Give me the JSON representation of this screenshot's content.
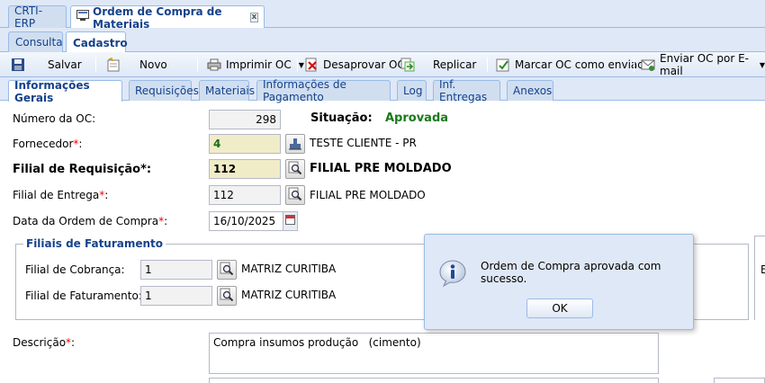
{
  "window_tabs": [
    {
      "label": "CRTI-ERP"
    },
    {
      "label": "Ordem de Compra de Materiais",
      "close": "x"
    }
  ],
  "mode_tabs": [
    {
      "label": "Consulta"
    },
    {
      "label": "Cadastro"
    }
  ],
  "toolbar": {
    "save": "Salvar",
    "new": "Novo",
    "print": "Imprimir OC",
    "disapprove": "Desaprovar OC",
    "replicate": "Replicar",
    "mark_sent": "Marcar OC como enviada",
    "send_email": "Enviar OC por E-mail"
  },
  "section_tabs": [
    {
      "label": "Informações Gerais"
    },
    {
      "label": "Requisições"
    },
    {
      "label": "Materiais"
    },
    {
      "label": "Informações de Pagamento"
    },
    {
      "label": "Log"
    },
    {
      "label": "Inf. Entregas"
    },
    {
      "label": "Anexos"
    }
  ],
  "form": {
    "oc_number_label": "Número da OC:",
    "oc_number": "298",
    "status_label": "Situação:",
    "status": "Aprovada",
    "status_color": "#1a7a1a",
    "supplier_label": "Fornecedor",
    "supplier_code": "4",
    "supplier_name": "TESTE CLIENTE - PR",
    "req_branch_label": "Filial de Requisição",
    "req_branch_code": "112",
    "req_branch_name": "FILIAL PRE MOLDADO",
    "delivery_branch_label": "Filial de Entrega",
    "delivery_branch_code": "112",
    "delivery_branch_name": "FILIAL PRE MOLDADO",
    "date_label": "Data da Ordem de Compra",
    "date": "16/10/2025",
    "billing_group_title": "Filiais de Faturamento",
    "collection_branch_label": "Filial de Cobrança:",
    "collection_branch_code": "1",
    "collection_branch_name": "MATRIZ CURITIBA",
    "billing_branch_label": "Filial de Faturamento:",
    "billing_branch_code": "1",
    "billing_branch_name": "MATRIZ CURITIBA",
    "description_label": "Descrição",
    "description": "Compra insumos produção   (cimento)",
    "required_mark": "*",
    "colon": ":",
    "side_fragment": "E"
  },
  "dialog": {
    "message": "Ordem de Compra aprovada com sucesso.",
    "ok": "OK",
    "icon": "info-icon"
  }
}
